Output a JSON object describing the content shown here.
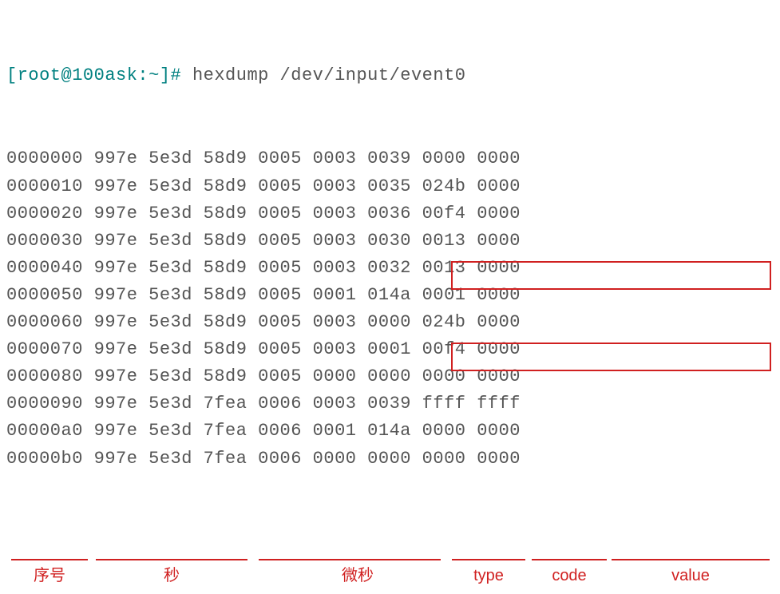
{
  "prompt": {
    "text": "[root@100ask:~]#",
    "command": "hexdump /dev/input/event0"
  },
  "chart_data": {
    "type": "table",
    "columns": [
      "offset",
      "sec_word1",
      "sec_word2",
      "usec_word1",
      "usec_word2",
      "type",
      "code",
      "value_word1",
      "value_word2"
    ],
    "rows": [
      [
        "0000000",
        "997e",
        "5e3d",
        "58d9",
        "0005",
        "0003",
        "0039",
        "0000",
        "0000"
      ],
      [
        "0000010",
        "997e",
        "5e3d",
        "58d9",
        "0005",
        "0003",
        "0035",
        "024b",
        "0000"
      ],
      [
        "0000020",
        "997e",
        "5e3d",
        "58d9",
        "0005",
        "0003",
        "0036",
        "00f4",
        "0000"
      ],
      [
        "0000030",
        "997e",
        "5e3d",
        "58d9",
        "0005",
        "0003",
        "0030",
        "0013",
        "0000"
      ],
      [
        "0000040",
        "997e",
        "5e3d",
        "58d9",
        "0005",
        "0003",
        "0032",
        "0013",
        "0000"
      ],
      [
        "0000050",
        "997e",
        "5e3d",
        "58d9",
        "0005",
        "0001",
        "014a",
        "0001",
        "0000"
      ],
      [
        "0000060",
        "997e",
        "5e3d",
        "58d9",
        "0005",
        "0003",
        "0000",
        "024b",
        "0000"
      ],
      [
        "0000070",
        "997e",
        "5e3d",
        "58d9",
        "0005",
        "0003",
        "0001",
        "00f4",
        "0000"
      ],
      [
        "0000080",
        "997e",
        "5e3d",
        "58d9",
        "0005",
        "0000",
        "0000",
        "0000",
        "0000"
      ],
      [
        "0000090",
        "997e",
        "5e3d",
        "7fea",
        "0006",
        "0003",
        "0039",
        "ffff",
        "ffff"
      ],
      [
        "00000a0",
        "997e",
        "5e3d",
        "7fea",
        "0006",
        "0001",
        "014a",
        "0000",
        "0000"
      ],
      [
        "00000b0",
        "997e",
        "5e3d",
        "7fea",
        "0006",
        "0000",
        "0000",
        "0000",
        "0000"
      ]
    ]
  },
  "labels": {
    "offset": "序号",
    "sec": "秒",
    "usec": "微秒",
    "type": "type",
    "code": "code",
    "value": "value"
  },
  "highlighted_rows": [
    8,
    11
  ],
  "colors": {
    "prompt": "#008080",
    "text": "#555555",
    "highlight": "#d02020"
  }
}
